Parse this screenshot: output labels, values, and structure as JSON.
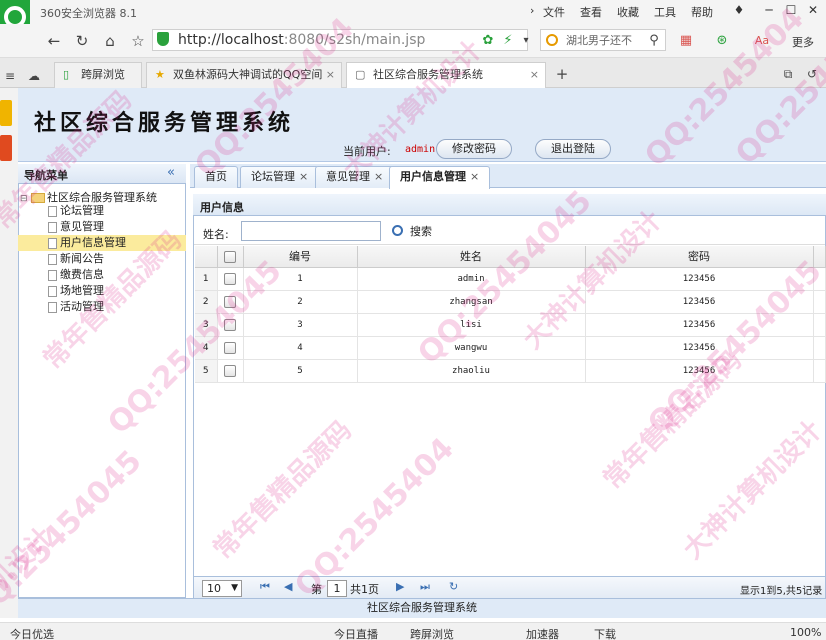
{
  "browser": {
    "app_title": "360安全浏览器 8.1",
    "menu": [
      "文件",
      "查看",
      "收藏",
      "工具",
      "帮助"
    ],
    "url_host": "http://localhost",
    "url_rest": ":8080/s2sh/main.jsp",
    "search_text": "湖北男子还不",
    "tabs": [
      {
        "label": "跨屏浏览"
      },
      {
        "label": "双鱼林源码大神调试的QQ空间"
      },
      {
        "label": "社区综合服务管理系统"
      }
    ],
    "more_label": "更多",
    "status": {
      "left": "今日优选",
      "items": [
        "今日直播",
        "跨屏浏览",
        "加速器",
        "下载"
      ],
      "zoom": "100%"
    }
  },
  "app": {
    "title": "社区综合服务管理系统",
    "current_user_label": "当前用户:",
    "current_user": "admin",
    "change_password": "修改密码",
    "logout": "退出登陆",
    "footer": "社区综合服务管理系统"
  },
  "sidebar": {
    "title": "导航菜单",
    "collapse": "«",
    "root": "社区综合服务管理系统",
    "items": [
      {
        "label": "论坛管理"
      },
      {
        "label": "意见管理"
      },
      {
        "label": "用户信息管理"
      },
      {
        "label": "新闻公告"
      },
      {
        "label": "缴费信息"
      },
      {
        "label": "场地管理"
      },
      {
        "label": "活动管理"
      }
    ]
  },
  "content": {
    "tabs": [
      {
        "label": "首页",
        "closable": false
      },
      {
        "label": "论坛管理",
        "closable": true
      },
      {
        "label": "意见管理",
        "closable": true
      },
      {
        "label": "用户信息管理",
        "closable": true
      }
    ],
    "close_glyph": "×",
    "panel_title": "用户信息",
    "name_label": "姓名:",
    "search_button": "搜索",
    "columns": [
      "编号",
      "姓名",
      "密码"
    ],
    "rows": [
      {
        "num": "1",
        "id": "1",
        "name": "admin",
        "password": "123456"
      },
      {
        "num": "2",
        "id": "2",
        "name": "zhangsan",
        "password": "123456"
      },
      {
        "num": "3",
        "id": "3",
        "name": "lisi",
        "password": "123456"
      },
      {
        "num": "4",
        "id": "4",
        "name": "wangwu",
        "password": "123456"
      },
      {
        "num": "5",
        "id": "5",
        "name": "zhaoliu",
        "password": "123456"
      }
    ],
    "pager": {
      "page_size": "10",
      "page_prefix": "第",
      "page": "1",
      "page_suffix": "共1页",
      "summary": "显示1到5,共5记录"
    }
  },
  "watermarks": [
    "常年售精品源码",
    "QQ:2545404",
    "大神计算机设计",
    "QQ:2545404",
    "常年售精品源码",
    "QQ:25454045",
    "大神计算机设计",
    "QQ:25454045",
    "常年售精品源码",
    "QQ:2545404",
    "常年售精品源码",
    "QQ:25454045",
    "大神计算机设计",
    "QQ:25454045",
    "机设计",
    "QQ:2545"
  ]
}
